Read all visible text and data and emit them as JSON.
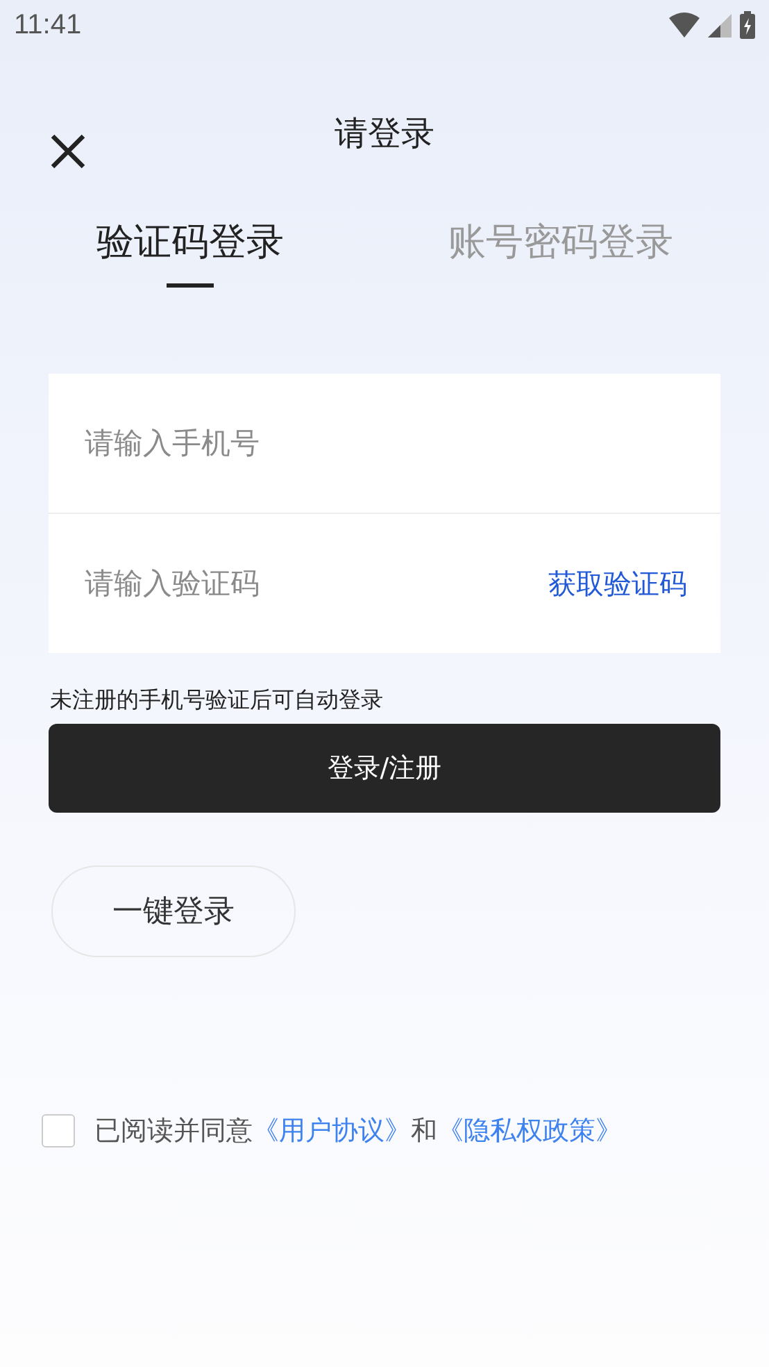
{
  "status_bar": {
    "time": "11:41"
  },
  "header": {
    "title": "请登录"
  },
  "tabs": [
    {
      "label": "验证码登录",
      "selected": true
    },
    {
      "label": "账号密码登录",
      "selected": false
    }
  ],
  "form": {
    "phone": {
      "placeholder": "请输入手机号"
    },
    "code": {
      "placeholder": "请输入验证码",
      "action": "获取验证码"
    }
  },
  "hint": "未注册的手机号验证后可自动登录",
  "submit_button": "登录/注册",
  "quick_login_button": "一键登录",
  "agreement": {
    "checked": false,
    "parts": [
      {
        "kind": "text",
        "text": "已阅读并同意"
      },
      {
        "kind": "link",
        "text": "《用户协议》"
      },
      {
        "kind": "text",
        "text": "和"
      },
      {
        "kind": "link",
        "text": "《隐私权政策》"
      }
    ]
  }
}
